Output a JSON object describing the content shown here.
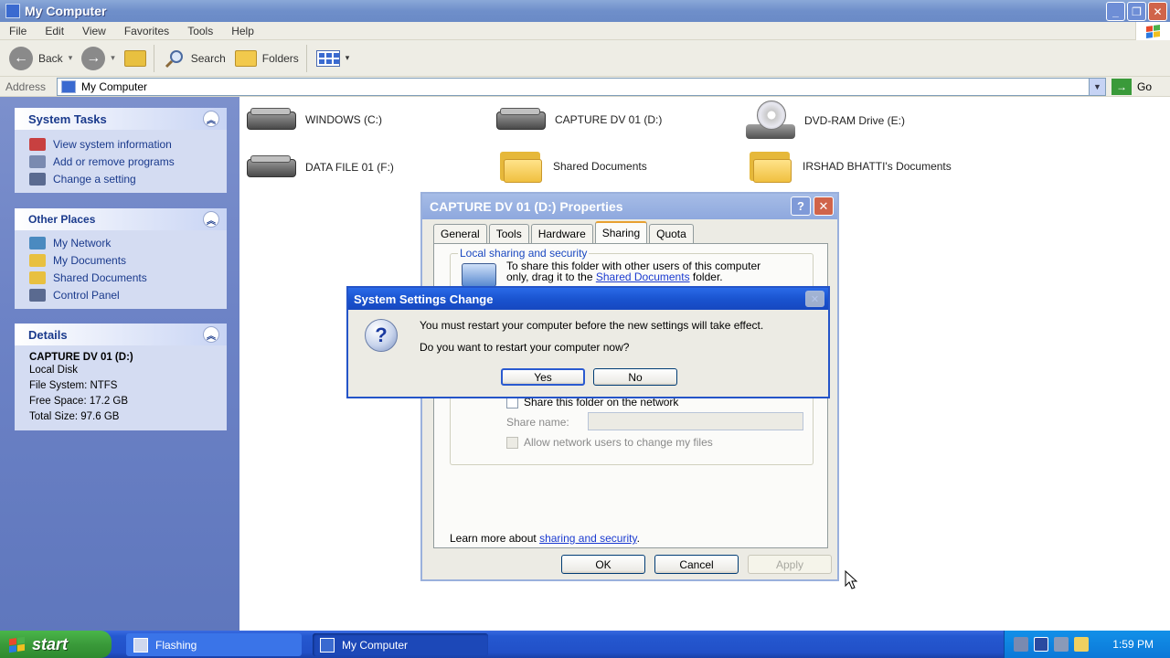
{
  "window": {
    "title": "My Computer"
  },
  "menu": [
    "File",
    "Edit",
    "View",
    "Favorites",
    "Tools",
    "Help"
  ],
  "toolbar": {
    "back": "Back",
    "search": "Search",
    "folders": "Folders"
  },
  "address": {
    "label": "Address",
    "value": "My Computer",
    "go": "Go"
  },
  "system_tasks": {
    "title": "System Tasks",
    "items": [
      "View system information",
      "Add or remove programs",
      "Change a setting"
    ]
  },
  "other_places": {
    "title": "Other Places",
    "items": [
      "My Network",
      "My Documents",
      "Shared Documents",
      "Control Panel"
    ]
  },
  "details": {
    "title": "Details",
    "name": "CAPTURE DV 01 (D:)",
    "type": "Local Disk",
    "file_system": "File System: NTFS",
    "free_space": "Free Space: 17.2 GB",
    "total_size": "Total Size: 97.6 GB"
  },
  "items": [
    {
      "label": "WINDOWS (C:)",
      "icon": "hard-drive-icon"
    },
    {
      "label": "CAPTURE DV 01 (D:)",
      "icon": "hard-drive-icon"
    },
    {
      "label": "DVD-RAM Drive (E:)",
      "icon": "dvd-drive-icon"
    },
    {
      "label": "DATA FILE 01 (F:)",
      "icon": "hard-drive-icon"
    },
    {
      "label": "Shared Documents",
      "icon": "folder-icon"
    },
    {
      "label": "IRSHAD BHATTI's Documents",
      "icon": "folder-icon"
    }
  ],
  "properties_dialog": {
    "title": "CAPTURE DV 01 (D:) Properties",
    "tabs": [
      "General",
      "Tools",
      "Hardware",
      "Sharing",
      "Quota"
    ],
    "active_tab": "Sharing",
    "local_group": "Local sharing and security",
    "local_text_1": "To share this folder with other users of this computer",
    "local_text_2": "only, drag it to the",
    "local_link": "Shared Documents",
    "local_text_3": "folder.",
    "share_checkbox": "Share this folder on the network",
    "share_name_label": "Share name:",
    "share_name_value": "",
    "allow_checkbox": "Allow network users to change my files",
    "learn_more": "Learn more about",
    "learn_link": "sharing and security",
    "ok": "OK",
    "cancel": "Cancel",
    "apply": "Apply"
  },
  "settings_dialog": {
    "title": "System Settings Change",
    "message": "You must restart your computer before the new settings will take effect.",
    "question": "Do you want to restart your computer now?",
    "yes": "Yes",
    "no": "No"
  },
  "taskbar": {
    "start": "start",
    "buttons": [
      "Flashing",
      "My Computer"
    ],
    "clock": "1:59 PM"
  }
}
